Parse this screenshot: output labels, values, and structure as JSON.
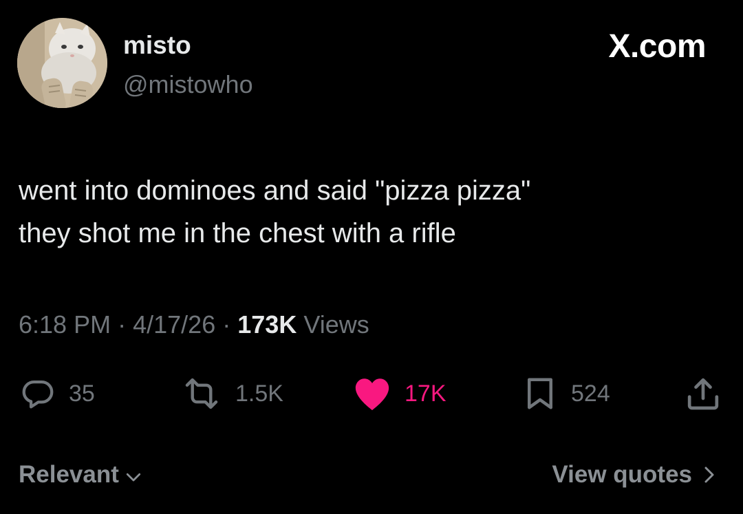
{
  "author": {
    "display_name": "misto",
    "handle": "@mistowho"
  },
  "brand": {
    "watermark": "X.com"
  },
  "tweet": {
    "lines": [
      "went into dominoes and said \"pizza pizza\"",
      "they shot me in the chest with a rifle"
    ]
  },
  "meta": {
    "time": "6:18 PM",
    "separator": "·",
    "date": "4/17/26",
    "views_count": "173K",
    "views_label": "Views"
  },
  "actions": {
    "replies": "35",
    "reposts": "1.5K",
    "likes": "17K",
    "bookmarks": "524"
  },
  "footer": {
    "sort_label": "Relevant",
    "quotes_label": "View quotes"
  },
  "colors": {
    "background": "#000000",
    "primary_text": "#e7e9ea",
    "secondary_text": "#71767b",
    "like_active": "#f91880"
  },
  "icons": {
    "reply": "reply-icon",
    "repost": "repost-icon",
    "like": "heart-icon",
    "bookmark": "bookmark-icon",
    "share": "share-icon",
    "sort": "chevron-down-icon",
    "quotes": "chevron-right-icon"
  }
}
